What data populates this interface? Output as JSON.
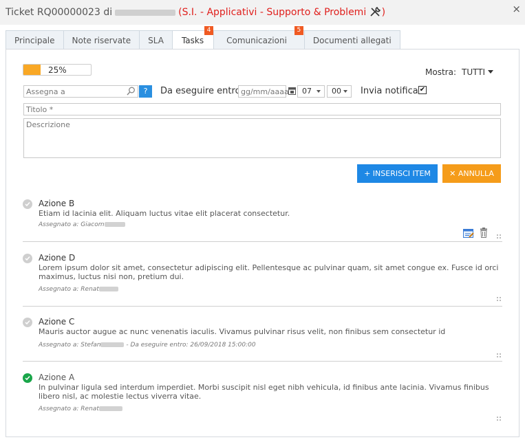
{
  "window": {
    "ticket_prefix": "Ticket RQ00000023 di",
    "ticket_category": "(S.I. - Applicativi - Supporto & Problemi",
    "ticket_category_close": ")",
    "close_glyph": "×"
  },
  "tabs": [
    {
      "label": "Principale"
    },
    {
      "label": "Note riservate"
    },
    {
      "label": "SLA"
    },
    {
      "label": "Tasks",
      "badge": "4",
      "active": true
    },
    {
      "label": "Comunicazioni",
      "badge": "5"
    },
    {
      "label": "Documenti allegati"
    }
  ],
  "progress": {
    "value": 0.25,
    "label": "25%"
  },
  "filter": {
    "label": "Mostra:",
    "value": "TUTTI"
  },
  "form": {
    "assign_placeholder": "Assegna a",
    "help_label": "?",
    "due_label": "Da eseguire entro",
    "date_placeholder": "gg/mm/aaaa",
    "hour": "07",
    "minute": "00",
    "notify_label": "Invia notifica",
    "notify_checked": "✔",
    "title_placeholder": "Titolo *",
    "description_placeholder": "Descrizione",
    "insert_label": "+ INSERISCI ITEM",
    "cancel_label": "✕ ANNULLA"
  },
  "tasks": [
    {
      "title": "Azione B",
      "description": "Etiam id lacinia elit. Aliquam luctus vitae elit placerat consectetur.",
      "assignee": "Assegnato a: Giacom",
      "done": false
    },
    {
      "title": "Azione D",
      "description": "Lorem ipsum dolor sit amet, consectetur adipiscing elit. Pellentesque ac pulvinar quam, sit amet congue ex. Fusce id orci maximus, luctus nisi non, pretium dui.",
      "assignee": "Assegnato a: Renat",
      "done": false
    },
    {
      "title": "Azione C",
      "description": "Mauris auctor augue ac nunc venenatis iaculis. Vivamus pulvinar risus velit, non finibus sem consectetur id",
      "assignee": "Assegnato a: Stefan",
      "due": "- Da eseguire entro: 26/09/2018 15:00:00",
      "done": false
    },
    {
      "title": "Azione A",
      "description": "In pulvinar ligula sed interdum imperdiet. Morbi suscipit nisl eget nibh vehicula, id finibus ante lacinia. Vivamus finibus libero nisl, ac molestie lectus viverra vitae.",
      "assignee": "Assegnato a: Renat",
      "done": true
    }
  ],
  "colors": {
    "accent_blue": "#1e88e5",
    "accent_orange": "#f59c1a",
    "badge": "#f05a22",
    "done_green": "#1aa64a",
    "title_red": "#e0201d"
  }
}
